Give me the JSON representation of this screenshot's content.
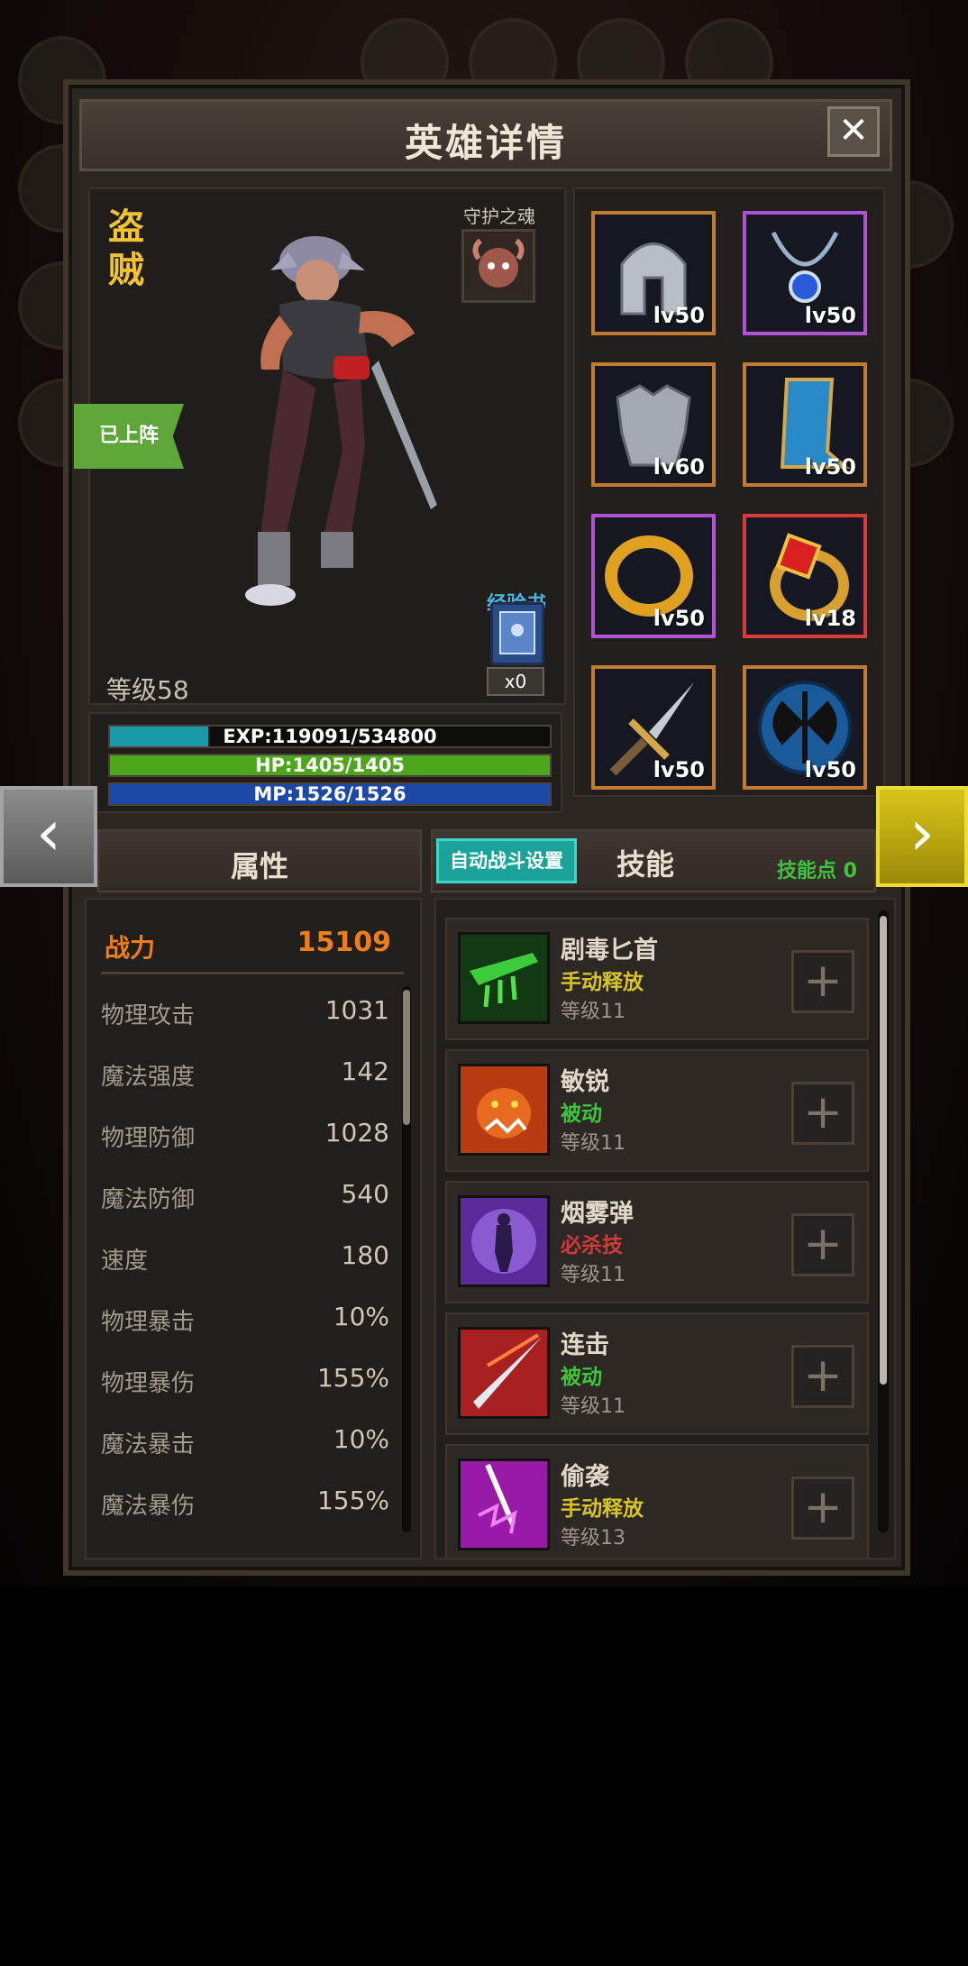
{
  "window": {
    "title": "英雄详情",
    "close_label": "✕"
  },
  "hero": {
    "class_name": "盗贼",
    "guardian_label": "守护之魂",
    "deployed_label": "已上阵",
    "level_label": "等级58",
    "exp_book_label": "经验书",
    "exp_book_count": "x0"
  },
  "bars": {
    "exp": {
      "text": "EXP:119091/534800",
      "fraction": 0.223,
      "color": "#1a9aa8"
    },
    "hp": {
      "text": "HP:1405/1405",
      "fraction": 1.0,
      "color": "#4ea61c"
    },
    "mp": {
      "text": "MP:1526/1526",
      "fraction": 1.0,
      "color": "#1c49a8"
    }
  },
  "equipment": [
    {
      "name": "helmet-icon",
      "level": "lv50",
      "border": "#c07c32"
    },
    {
      "name": "amulet-icon",
      "level": "lv50",
      "border": "#b052d4"
    },
    {
      "name": "armor-icon",
      "level": "lv60",
      "border": "#c07c32"
    },
    {
      "name": "boots-icon",
      "level": "lv50",
      "border": "#c07c32"
    },
    {
      "name": "ring-gold-icon",
      "level": "lv50",
      "border": "#b052d4"
    },
    {
      "name": "ring-ruby-icon",
      "level": "lv18",
      "border": "#d83a3a"
    },
    {
      "name": "dagger-icon",
      "level": "lv50",
      "border": "#c07c32"
    },
    {
      "name": "shield-axe-icon",
      "level": "lv50",
      "border": "#c07c32"
    }
  ],
  "nav": {
    "prev_label": "‹",
    "next_label": "›"
  },
  "attributes": {
    "header": "属性",
    "power_label": "战力",
    "power_value": "15109",
    "stats": [
      {
        "name": "物理攻击",
        "value": "1031"
      },
      {
        "name": "魔法强度",
        "value": "142"
      },
      {
        "name": "物理防御",
        "value": "1028"
      },
      {
        "name": "魔法防御",
        "value": "540"
      },
      {
        "name": "速度",
        "value": "180"
      },
      {
        "name": "物理暴击",
        "value": "10%"
      },
      {
        "name": "物理暴伤",
        "value": "155%"
      },
      {
        "name": "魔法暴击",
        "value": "10%"
      },
      {
        "name": "魔法暴伤",
        "value": "155%"
      }
    ]
  },
  "skills": {
    "auto_battle_label": "自动战斗设置",
    "header": "技能",
    "points_label": "技能点 0",
    "list": [
      {
        "name": "剧毒匕首",
        "type": "手动释放",
        "type_color": "#d6c42a",
        "level": "等级11",
        "icon": "poison-dagger-icon"
      },
      {
        "name": "敏锐",
        "type": "被动",
        "type_color": "#3ec43e",
        "level": "等级11",
        "icon": "beast-icon"
      },
      {
        "name": "烟雾弹",
        "type": "必杀技",
        "type_color": "#d23a3a",
        "level": "等级11",
        "icon": "smoke-bomb-icon"
      },
      {
        "name": "连击",
        "type": "被动",
        "type_color": "#3ec43e",
        "level": "等级11",
        "icon": "combo-strike-icon"
      },
      {
        "name": "偷袭",
        "type": "手动释放",
        "type_color": "#d6c42a",
        "level": "等级13",
        "icon": "sneak-attack-icon"
      }
    ]
  }
}
